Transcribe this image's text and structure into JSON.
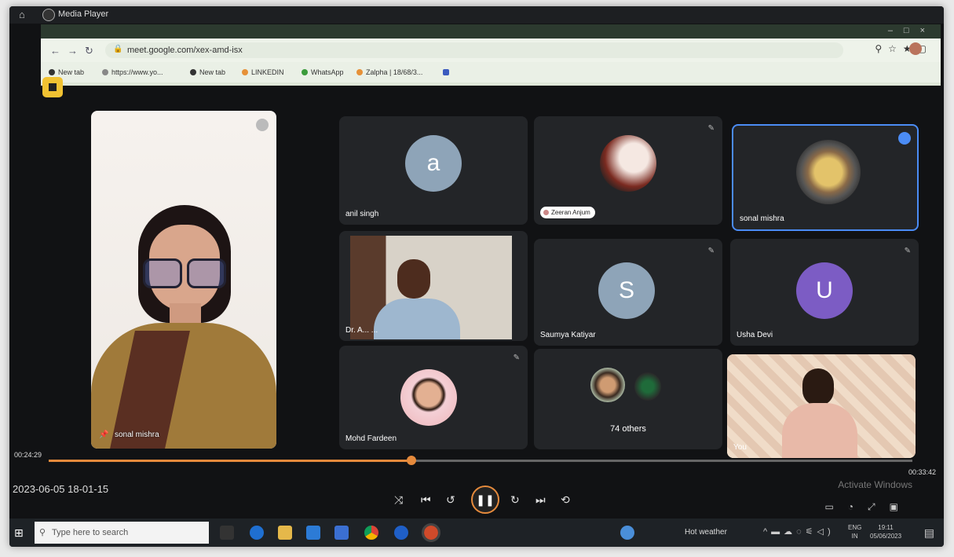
{
  "media_player": {
    "title": "Media Player"
  },
  "browser": {
    "url": "meet.google.com/xex-amd-isx",
    "bookmarks": [
      "New tab",
      "https://www.yo...",
      "New tab",
      "LINKEDIN",
      "WhatsApp",
      "Zalpha | 18/68/3...",
      ""
    ]
  },
  "meet": {
    "self": {
      "name": "sonal mishra"
    },
    "tiles": [
      {
        "name": "anil singh",
        "avatar_letter": "a",
        "avatar_color": "#8ea4b8"
      },
      {
        "name": "",
        "chip": "Zeeran Anjum"
      },
      {
        "name": "sonal mishra",
        "active": true
      },
      {
        "name": "Dr. A... ..."
      },
      {
        "name": "Saumya Katiyar",
        "avatar_letter": "S",
        "avatar_color": "#8ea4b8"
      },
      {
        "name": "Usha Devi",
        "avatar_letter": "U",
        "avatar_color": "#7c5cc4"
      },
      {
        "name": "Mohd Fardeen"
      },
      {
        "name": "74 others"
      },
      {
        "name": "You"
      }
    ]
  },
  "player": {
    "current_time": "00:24:29",
    "total_time": "00:33:42",
    "progress": 0.42,
    "timestamp": "2023-06-05 18-01-15",
    "activate": "Activate Windows"
  },
  "taskbar": {
    "search_placeholder": "Type here to search",
    "weather": "Hot weather",
    "lang": [
      "ENG",
      "IN"
    ],
    "time": "19:11",
    "date": "05/06/2023"
  },
  "colors": {
    "accent": "#e58a3c",
    "meet_yellow": "#f1c232",
    "active_border": "#4b8cf5"
  }
}
